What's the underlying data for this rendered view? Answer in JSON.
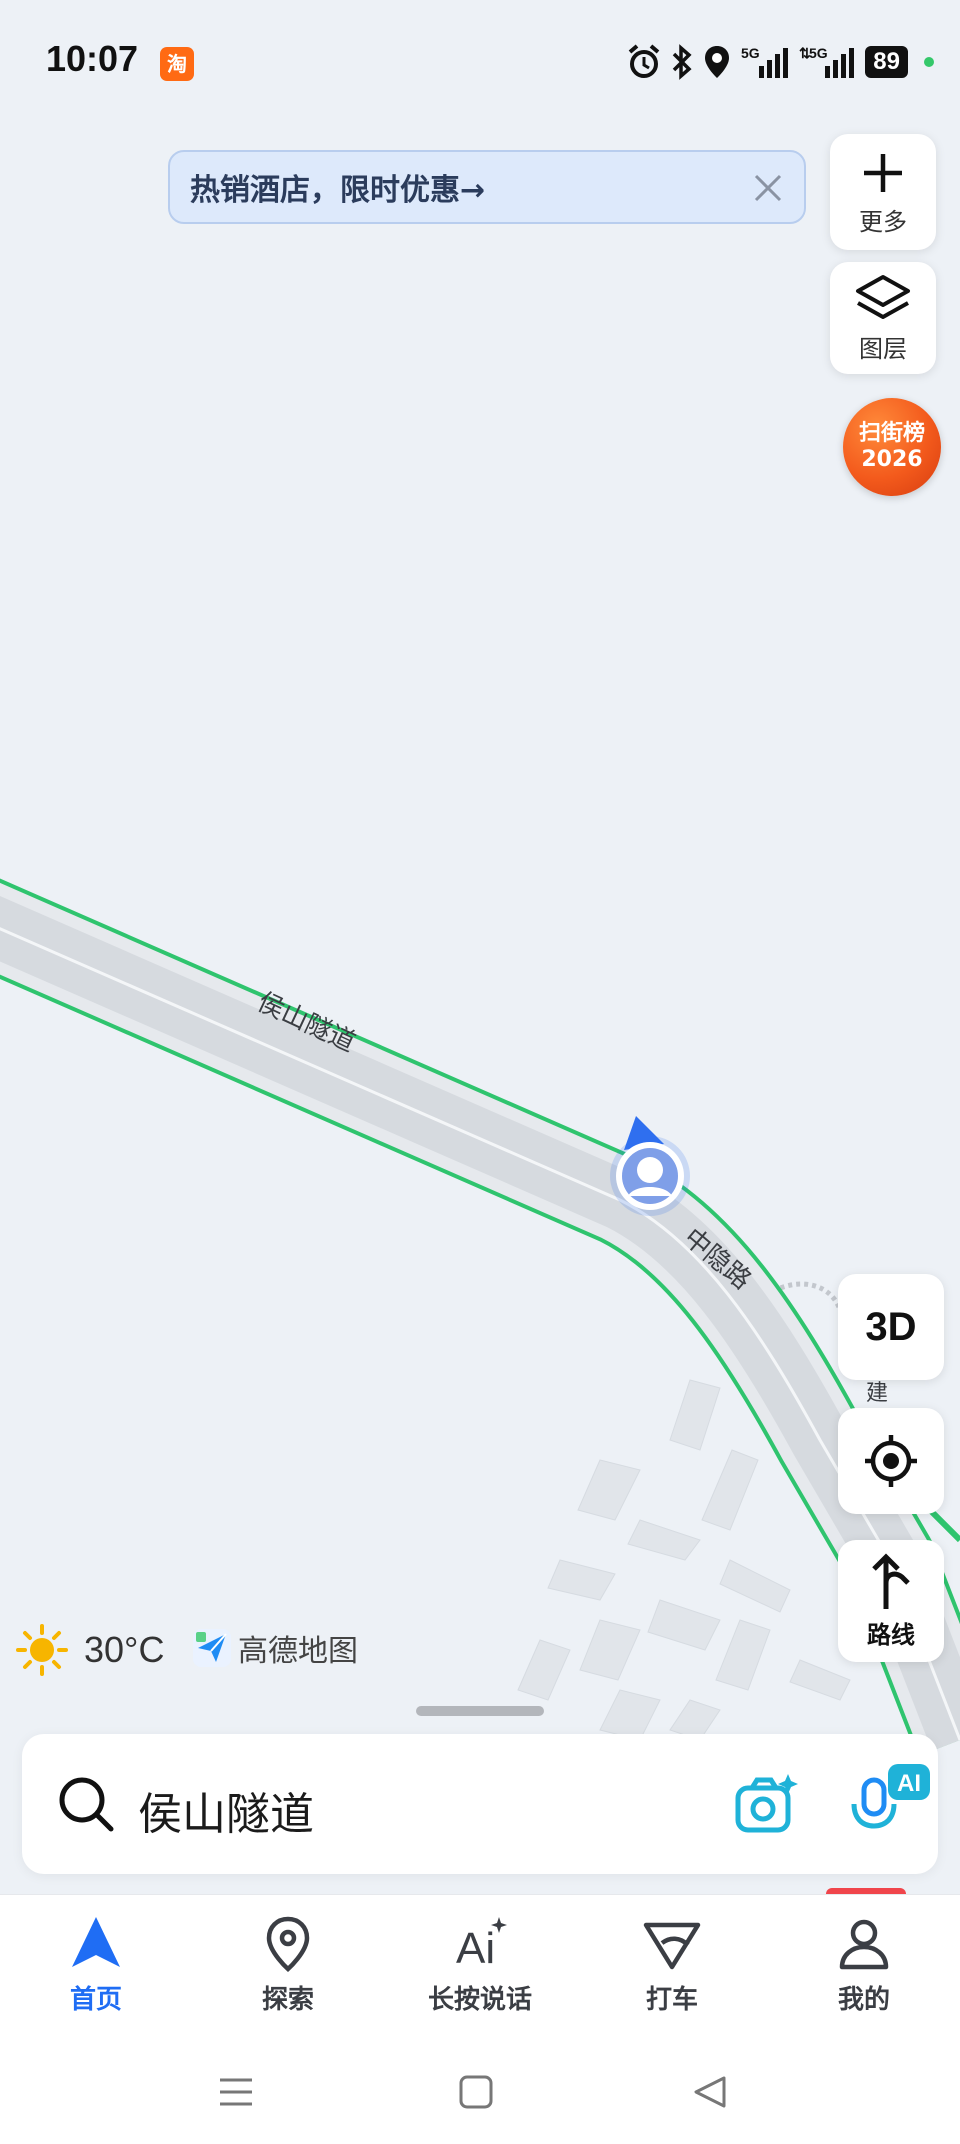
{
  "status_bar": {
    "time": "10:07",
    "app_badge": "淘",
    "signal_1": "5G",
    "signal_2": "5G",
    "battery": "89"
  },
  "promo": {
    "text": "热销酒店，限时优惠→"
  },
  "side_controls": {
    "more_label": "更多",
    "layers_label": "图层",
    "ranking_line1": "扫街榜",
    "ranking_line2": "2026",
    "three_d_label": "3D",
    "route_label": "路线"
  },
  "map": {
    "road_labels": [
      "侯山隧道",
      "中隐路",
      "建"
    ]
  },
  "weather": {
    "temperature": "30°C",
    "icon": "sun-icon"
  },
  "brand": {
    "name": "高德地图"
  },
  "search": {
    "value": "侯山隧道",
    "ai_badge": "AI"
  },
  "bottom_nav": {
    "items": [
      {
        "label": "首页",
        "icon": "navigation-arrow-icon",
        "active": true
      },
      {
        "label": "探索",
        "icon": "map-pin-icon",
        "active": false
      },
      {
        "label": "长按说话",
        "icon": "ai-voice-icon",
        "active": false
      },
      {
        "label": "打车",
        "icon": "taxi-icon",
        "active": false
      },
      {
        "label": "我的",
        "icon": "profile-icon",
        "active": false
      }
    ]
  },
  "colors": {
    "accent": "#1f6df4",
    "road_edge": "#2fc46e",
    "road_fill": "#d9dde2",
    "map_bg": "#edf1f6",
    "ranking": "#f35a1c"
  }
}
